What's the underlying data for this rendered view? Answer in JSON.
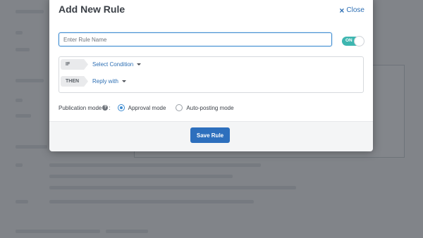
{
  "modal": {
    "title": "Add New Rule",
    "close_label": "Close"
  },
  "rule_name": {
    "placeholder": "Enter Rule Name",
    "value": ""
  },
  "toggle": {
    "label": "ON",
    "state": "on",
    "color": "#3db6b0"
  },
  "conditions": {
    "if_label": "IF",
    "if_select": "Select Condition",
    "then_label": "THEN",
    "then_select": "Reply with"
  },
  "publication": {
    "label": "Publication mode",
    "help_icon": "?",
    "suffix": ":",
    "options": [
      {
        "label": "Approval mode",
        "selected": true
      },
      {
        "label": "Auto-posting mode",
        "selected": false
      }
    ]
  },
  "footer": {
    "save_label": "Save Rule",
    "save_color": "#2d6fbd"
  }
}
